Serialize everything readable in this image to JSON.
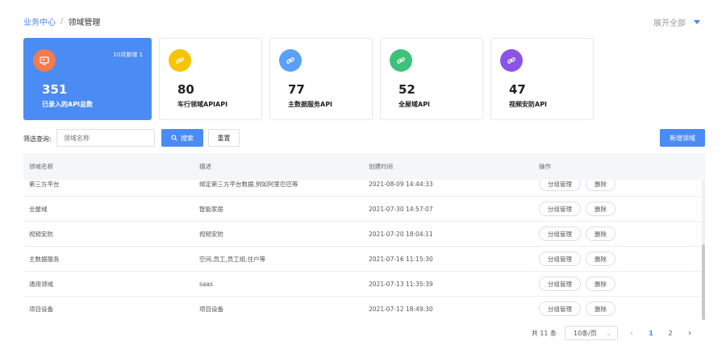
{
  "breadcrumb": {
    "parent": "业务中心",
    "separator": "/",
    "current": "领域管理"
  },
  "expand_all": "展开全部",
  "cards": [
    {
      "number": "351",
      "label": "已录入的API总数",
      "badge": "10月新增 1",
      "icon": "monitor-icon",
      "color": "#f37b4e"
    },
    {
      "number": "80",
      "label": "车行领域APIAPI",
      "icon": "link-icon",
      "color": "#f6c400"
    },
    {
      "number": "77",
      "label": "主数据服务API",
      "icon": "link-icon",
      "color": "#5aa0f7"
    },
    {
      "number": "52",
      "label": "全屋域API",
      "icon": "link-icon",
      "color": "#3ec27a"
    },
    {
      "number": "47",
      "label": "视频安防API",
      "icon": "link-icon",
      "color": "#8a55e6"
    }
  ],
  "filter": {
    "label": "筛选查询:",
    "placeholder": "领域名称",
    "search_label": "搜索",
    "reset_label": "重置",
    "add_label": "新增领域"
  },
  "table": {
    "headers": [
      "领域名称",
      "描述",
      "创建时间",
      "操作"
    ],
    "rows": [
      {
        "name": "第三方平台",
        "desc": "绑定第三方平台数据,例如阿里巴巴等",
        "time": "2021-08-09 14:44:33"
      },
      {
        "name": "全屋域",
        "desc": "智能家居",
        "time": "2021-07-30 14:57:07"
      },
      {
        "name": "视频安防",
        "desc": "视频安防",
        "time": "2021-07-20 18:04:11"
      },
      {
        "name": "主数据服务",
        "desc": "空间,员工,员工组,住户等",
        "time": "2021-07-16 11:15:30"
      },
      {
        "name": "通用领域",
        "desc": "saas",
        "time": "2021-07-13 11:35:39"
      },
      {
        "name": "项目设备",
        "desc": "项目设备",
        "time": "2021-07-12 18:49:30"
      }
    ],
    "op_group": "分组管理",
    "op_delete": "删除"
  },
  "pagination": {
    "total": "共 11 条",
    "page_size": "10条/页",
    "pages": [
      "1",
      "2"
    ],
    "current": "1"
  }
}
